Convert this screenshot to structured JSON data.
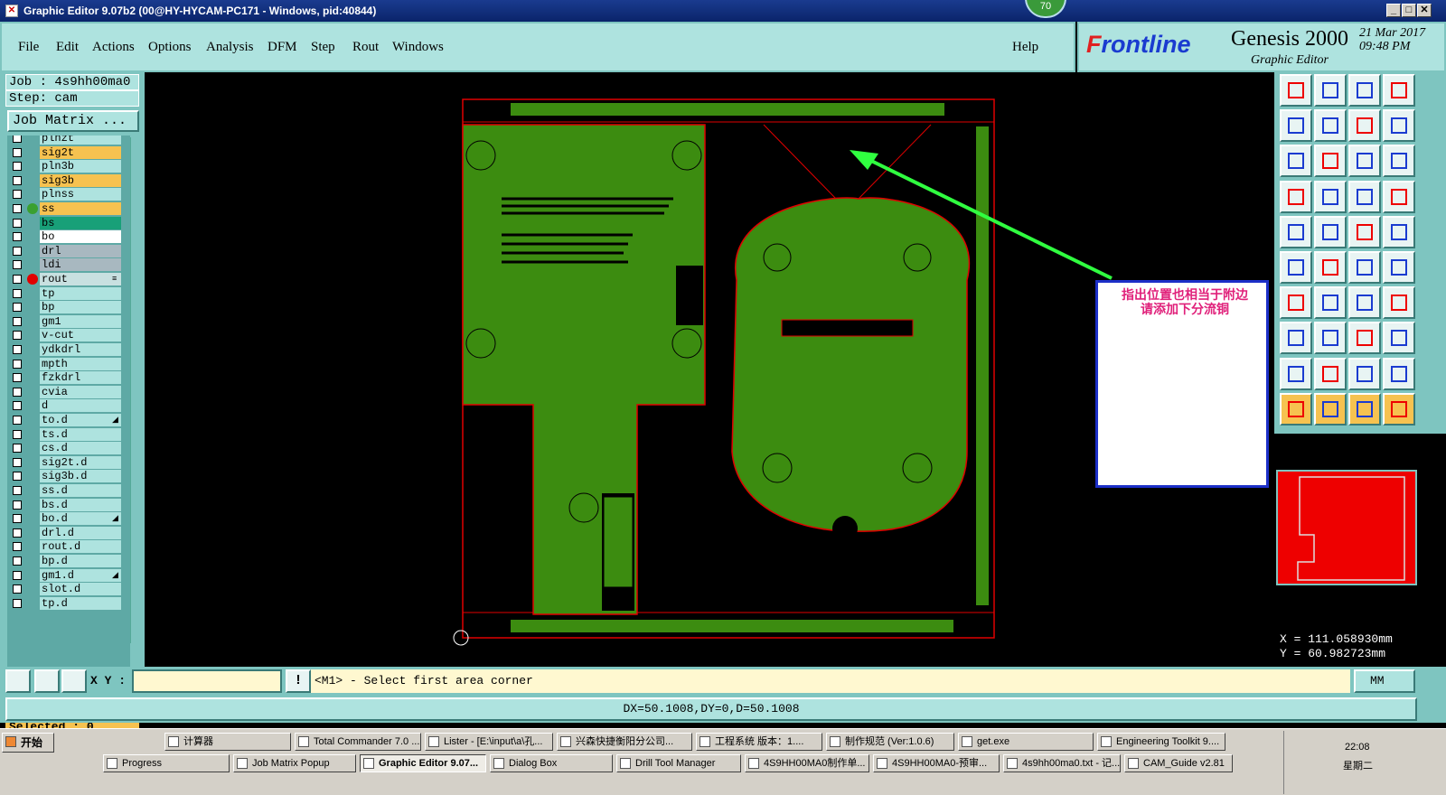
{
  "window": {
    "title": "Graphic Editor 9.07b2 (00@HY-HYCAM-PC171 - Windows, pid:40844)",
    "badge": "70",
    "controls": [
      "_",
      "□",
      "✕"
    ]
  },
  "menu": {
    "items": [
      "File",
      "Edit",
      "Actions",
      "Options",
      "Analysis",
      "DFM",
      "Step",
      "Rout",
      "Windows"
    ],
    "help": "Help"
  },
  "brand": {
    "logo_f": "F",
    "logo_rest": "rontline",
    "product": "Genesis 2000",
    "subtitle": "Graphic Editor",
    "date_line1": "21 Mar 2017",
    "date_line2": "09:48 PM"
  },
  "job": {
    "job_line": "Job : 4s9hh00ma0",
    "step_line": "Step: cam",
    "matrix_button": "Job Matrix ..."
  },
  "layers": [
    {
      "name": "plnzt",
      "color": "#aee3df",
      "dot": ""
    },
    {
      "name": "sig2t",
      "color": "#f6c250",
      "dot": ""
    },
    {
      "name": "pln3b",
      "color": "#aee3df",
      "dot": ""
    },
    {
      "name": "sig3b",
      "color": "#f6c250",
      "dot": ""
    },
    {
      "name": "plnss",
      "color": "#aee3df",
      "dot": ""
    },
    {
      "name": "ss",
      "color": "#f6c250",
      "dot": "#3aa030"
    },
    {
      "name": "bs",
      "color": "#18a078",
      "dot": ""
    },
    {
      "name": "bo",
      "color": "#ffffff",
      "dot": ""
    },
    {
      "name": "drl",
      "color": "#a8b8c0",
      "dot": ""
    },
    {
      "name": "ldi",
      "color": "#a8b8c0",
      "dot": ""
    },
    {
      "name": "rout",
      "color": "#c8e0e0",
      "dot": "#e00000",
      "mark": "≡"
    },
    {
      "name": "tp",
      "color": "#aee3df",
      "dot": ""
    },
    {
      "name": "bp",
      "color": "#aee3df",
      "dot": ""
    },
    {
      "name": "gm1",
      "color": "#aee3df",
      "dot": ""
    },
    {
      "name": "v-cut",
      "color": "#aee3df",
      "dot": ""
    },
    {
      "name": "ydkdrl",
      "color": "#aee3df",
      "dot": ""
    },
    {
      "name": "mpth",
      "color": "#aee3df",
      "dot": ""
    },
    {
      "name": "fzkdrl",
      "color": "#aee3df",
      "dot": ""
    },
    {
      "name": "cvia",
      "color": "#aee3df",
      "dot": ""
    },
    {
      "name": "d",
      "color": "#aee3df",
      "dot": ""
    },
    {
      "name": "to.d",
      "color": "#aee3df",
      "dot": "",
      "mark": "◢"
    },
    {
      "name": "ts.d",
      "color": "#aee3df",
      "dot": ""
    },
    {
      "name": "cs.d",
      "color": "#aee3df",
      "dot": ""
    },
    {
      "name": "sig2t.d",
      "color": "#aee3df",
      "dot": ""
    },
    {
      "name": "sig3b.d",
      "color": "#aee3df",
      "dot": ""
    },
    {
      "name": "ss.d",
      "color": "#aee3df",
      "dot": ""
    },
    {
      "name": "bs.d",
      "color": "#aee3df",
      "dot": ""
    },
    {
      "name": "bo.d",
      "color": "#aee3df",
      "dot": "",
      "mark": "◢"
    },
    {
      "name": "drl.d",
      "color": "#aee3df",
      "dot": ""
    },
    {
      "name": "rout.d",
      "color": "#aee3df",
      "dot": ""
    },
    {
      "name": "bp.d",
      "color": "#aee3df",
      "dot": ""
    },
    {
      "name": "gm1.d",
      "color": "#aee3df",
      "dot": "",
      "mark": "◢"
    },
    {
      "name": "slot.d",
      "color": "#aee3df",
      "dot": ""
    },
    {
      "name": "tp.d",
      "color": "#aee3df",
      "dot": ""
    }
  ],
  "selected": "Selected : 0",
  "annotation": {
    "line1": "指出位置也相当于附边",
    "line2": "请添加下分流铜"
  },
  "coords": {
    "x": "X = 111.058930mm",
    "y": "Y = 60.982723mm"
  },
  "command": {
    "xy_label": "X Y :",
    "xy_value": "",
    "prompt": "<M1> - Select first area corner",
    "unit": "MM"
  },
  "status": "DX=50.1008,DY=0,D=50.1008",
  "taskbar": {
    "start": "开始",
    "row1": [
      "计算器",
      "Total Commander 7.0 ...",
      "Lister - [E:\\input\\a\\孔...",
      "兴森快捷衡阳分公司...",
      "工程系统  版本：1....",
      "制作规范 (Ver:1.0.6)",
      "get.exe",
      "Engineering Toolkit 9...."
    ],
    "row2": [
      "Progress",
      "Job Matrix Popup",
      "Graphic Editor 9.07...",
      "Dialog Box",
      "Drill Tool Manager",
      "4S9HH00MA0制作单...",
      "4S9HH00MA0-预审...",
      "4s9hh00ma0.txt - 记...",
      "CAM_Guide v2.81"
    ],
    "clock": "22:08",
    "weekday": "星期二"
  },
  "colors": {
    "panel": "#7ec5c0",
    "panel_light": "#aee3df",
    "board_fill": "#3c8c10",
    "board_outline": "#e00000",
    "arrow": "#30ff40"
  }
}
